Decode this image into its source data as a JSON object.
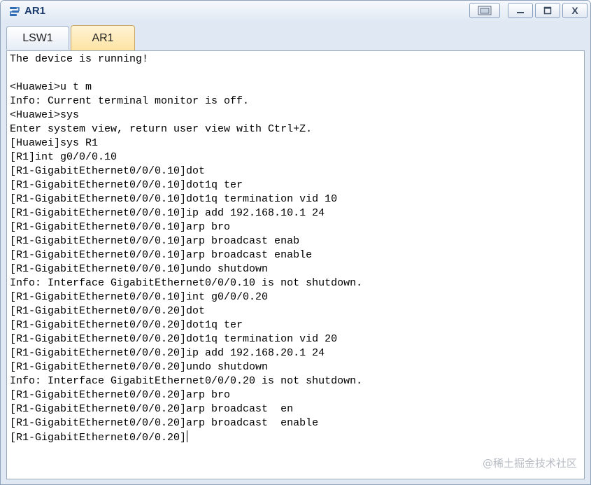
{
  "window": {
    "title": "AR1",
    "controls": {
      "restore_icon": "restore-panel-icon",
      "minimize_icon": "minimize-icon",
      "maximize_icon": "maximize-icon",
      "close_label": "X"
    }
  },
  "tabs": [
    {
      "label": "LSW1",
      "active": false
    },
    {
      "label": "AR1",
      "active": true
    }
  ],
  "terminal": {
    "lines": [
      "The device is running!",
      "",
      "<Huawei>u t m",
      "Info: Current terminal monitor is off.",
      "<Huawei>sys",
      "Enter system view, return user view with Ctrl+Z.",
      "[Huawei]sys R1",
      "[R1]int g0/0/0.10",
      "[R1-GigabitEthernet0/0/0.10]dot",
      "[R1-GigabitEthernet0/0/0.10]dot1q ter",
      "[R1-GigabitEthernet0/0/0.10]dot1q termination vid 10",
      "[R1-GigabitEthernet0/0/0.10]ip add 192.168.10.1 24",
      "[R1-GigabitEthernet0/0/0.10]arp bro",
      "[R1-GigabitEthernet0/0/0.10]arp broadcast enab",
      "[R1-GigabitEthernet0/0/0.10]arp broadcast enable",
      "[R1-GigabitEthernet0/0/0.10]undo shutdown",
      "Info: Interface GigabitEthernet0/0/0.10 is not shutdown.",
      "[R1-GigabitEthernet0/0/0.10]int g0/0/0.20",
      "[R1-GigabitEthernet0/0/0.20]dot",
      "[R1-GigabitEthernet0/0/0.20]dot1q ter",
      "[R1-GigabitEthernet0/0/0.20]dot1q termination vid 20",
      "[R1-GigabitEthernet0/0/0.20]ip add 192.168.20.1 24",
      "[R1-GigabitEthernet0/0/0.20]undo shutdown",
      "Info: Interface GigabitEthernet0/0/0.20 is not shutdown.",
      "[R1-GigabitEthernet0/0/0.20]arp bro",
      "[R1-GigabitEthernet0/0/0.20]arp broadcast  en",
      "[R1-GigabitEthernet0/0/0.20]arp broadcast  enable",
      "[R1-GigabitEthernet0/0/0.20]"
    ]
  },
  "watermark": "@稀土掘金技术社区"
}
